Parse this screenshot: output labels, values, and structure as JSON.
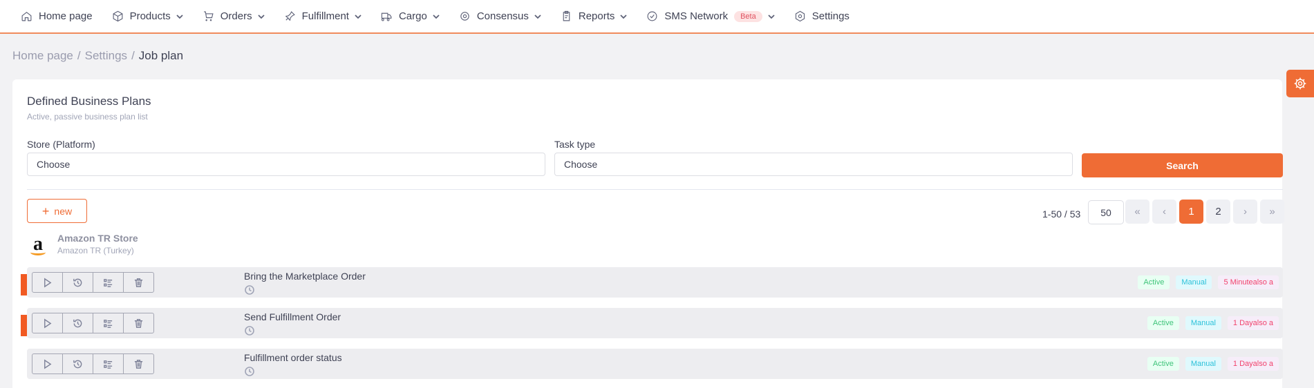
{
  "nav": {
    "items": [
      {
        "label": "Home page",
        "icon": "home-icon",
        "dropdown": false
      },
      {
        "label": "Products",
        "icon": "box-icon",
        "dropdown": true
      },
      {
        "label": "Orders",
        "icon": "cart-icon",
        "dropdown": true
      },
      {
        "label": "Fulfillment",
        "icon": "pin-icon",
        "dropdown": true
      },
      {
        "label": "Cargo",
        "icon": "truck-icon",
        "dropdown": true
      },
      {
        "label": "Consensus",
        "icon": "consensus-icon",
        "dropdown": true
      },
      {
        "label": "Reports",
        "icon": "clipboard-icon",
        "dropdown": true
      },
      {
        "label": "SMS Network",
        "icon": "check-circle-icon",
        "dropdown": true,
        "badge": "Beta"
      },
      {
        "label": "Settings",
        "icon": "settings-icon",
        "dropdown": false
      }
    ]
  },
  "breadcrumb": {
    "home": "Home page",
    "settings": "Settings",
    "current": "Job plan"
  },
  "card": {
    "title": "Defined Business Plans",
    "subtitle": "Active, passive business plan list"
  },
  "filters": {
    "store_label": "Store (Platform)",
    "store_value": "Choose",
    "task_label": "Task type",
    "task_value": "Choose",
    "search_label": "Search"
  },
  "toolbar": {
    "new_label": "new"
  },
  "pagination": {
    "info": "1-50 / 53",
    "page_size": "50",
    "first": "«",
    "prev": "‹",
    "pages": [
      "1",
      "2"
    ],
    "current_page": "1",
    "next": "›",
    "last": "»"
  },
  "store": {
    "name": "Amazon TR Store",
    "region": "Amazon TR (Turkey)",
    "logo_text": "a"
  },
  "jobs": [
    {
      "title": "Bring the Marketplace Order",
      "status": "Active",
      "mode": "Manual",
      "frequency": "5 Minutealso a",
      "marker": true
    },
    {
      "title": "Send Fulfillment Order",
      "status": "Active",
      "mode": "Manual",
      "frequency": "1 Dayalso a",
      "marker": true
    },
    {
      "title": "Fulfillment order status",
      "status": "Active",
      "mode": "Manual",
      "frequency": "1 Dayalso a",
      "marker": false
    }
  ],
  "colors": {
    "accent": "#ef6c35",
    "marker": "#f15a22",
    "active": "#3fc47a",
    "manual": "#2cc1d9",
    "frequency": "#f1416c"
  }
}
